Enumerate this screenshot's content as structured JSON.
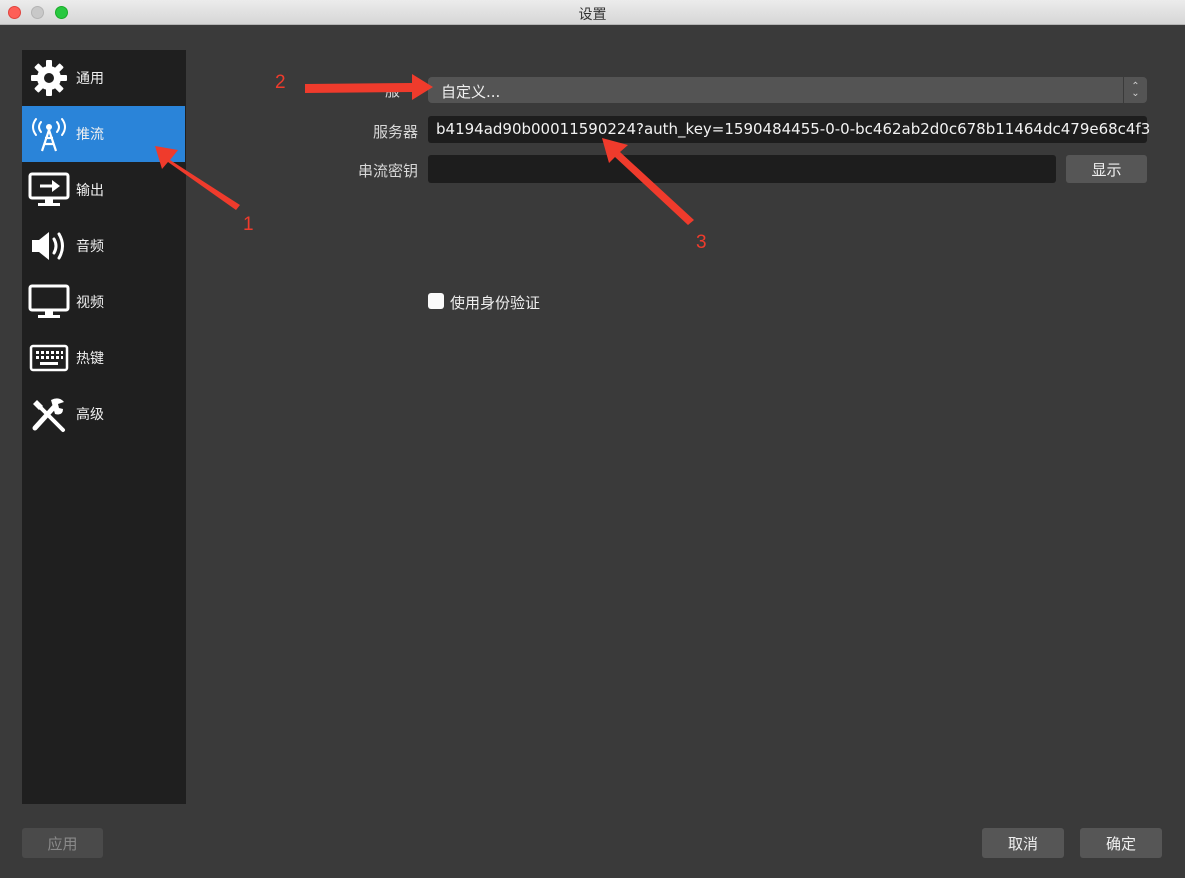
{
  "window": {
    "title": "设置"
  },
  "sidebar": {
    "items": [
      {
        "label": "通用",
        "icon": "gear-icon",
        "active": false
      },
      {
        "label": "推流",
        "icon": "antenna-icon",
        "active": true
      },
      {
        "label": "输出",
        "icon": "output-monitor-icon",
        "active": false
      },
      {
        "label": "音频",
        "icon": "speaker-icon",
        "active": false
      },
      {
        "label": "视频",
        "icon": "monitor-icon",
        "active": false
      },
      {
        "label": "热键",
        "icon": "keyboard-icon",
        "active": false
      },
      {
        "label": "高级",
        "icon": "tools-icon",
        "active": false
      }
    ]
  },
  "stream": {
    "service_label": "服",
    "service_value": "自定义...",
    "server_label": "服务器",
    "server_value": "b4194ad90b00011590224?auth_key=1590484455-0-0-bc462ab2d0c678b11464dc479e68c4f3",
    "key_label": "串流密钥",
    "key_value": "",
    "show_button": "显示",
    "auth_checkbox_label": "使用身份验证",
    "auth_checked": false
  },
  "footer": {
    "apply_button": "应用",
    "cancel_button": "取消",
    "ok_button": "确定"
  },
  "annotations": {
    "one": "1",
    "two": "2",
    "three": "3",
    "color": "#ef3b2c"
  }
}
